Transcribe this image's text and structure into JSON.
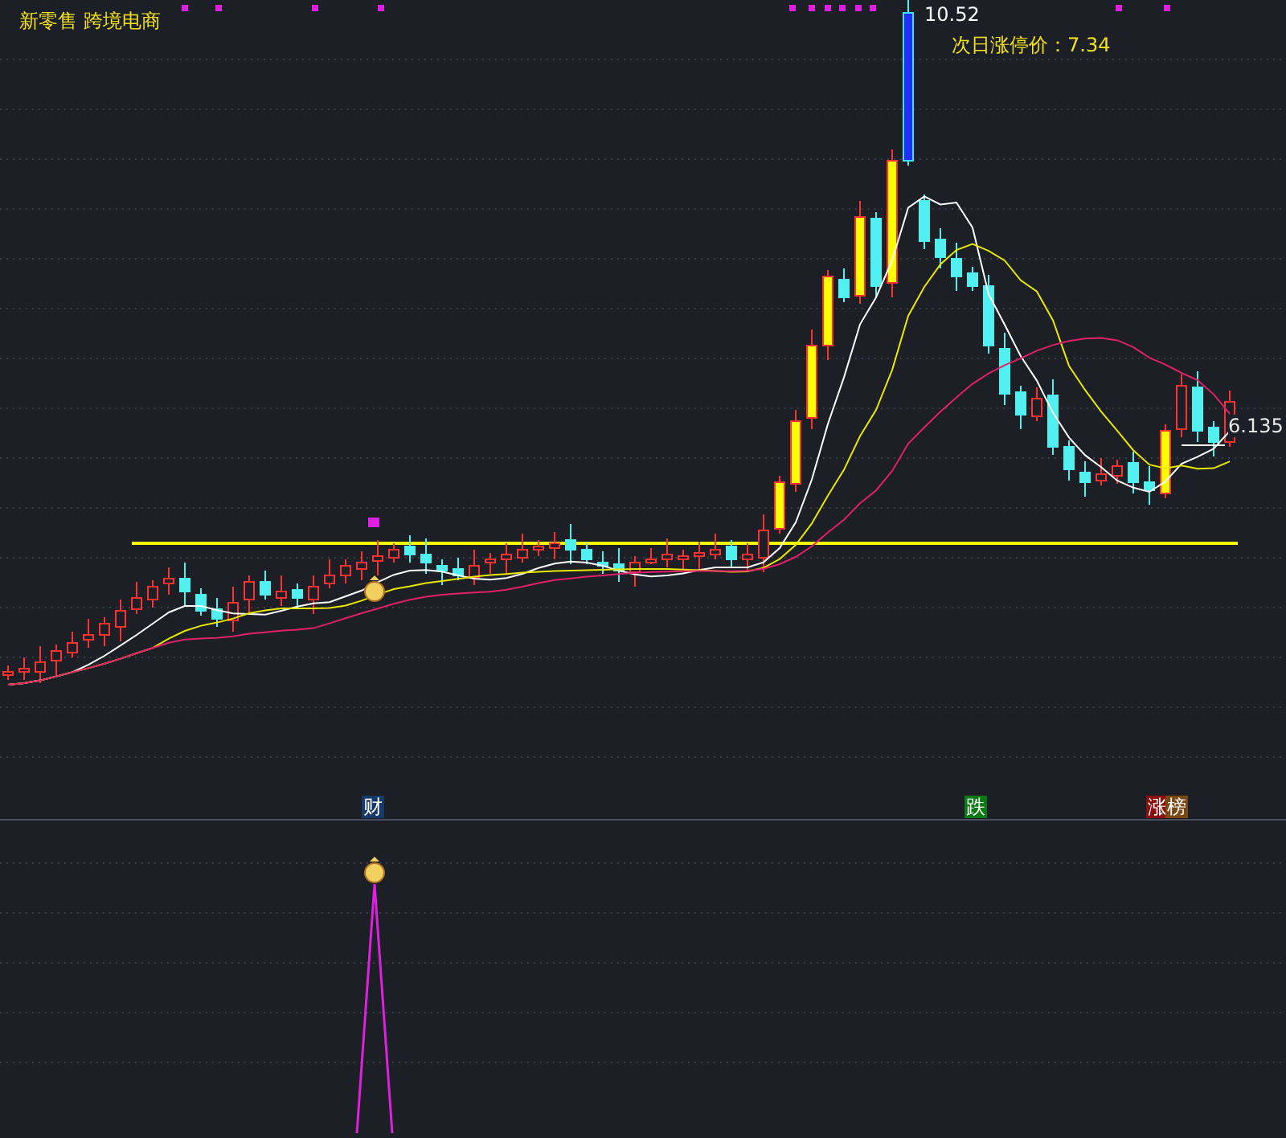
{
  "chart_title": "新零售 跨境电商",
  "high_label": "10.52",
  "next_limit_price": "次日涨停价：7.34",
  "last_price_label": "6.135",
  "signals": [
    {
      "text": "财",
      "color": "#173a6b"
    },
    {
      "text": "跌",
      "color": "#0b7a14"
    },
    {
      "text": "涨",
      "color": "#8a0f0f"
    },
    {
      "text": "榜",
      "color": "#7a4612"
    }
  ]
}
